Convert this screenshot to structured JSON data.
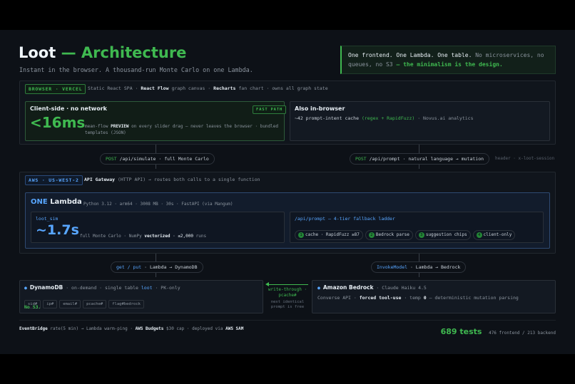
{
  "header": {
    "title_main": "Loot",
    "title_rest": "— Architecture",
    "subtitle": "Instant in the browser. A thousand-run Monte Carlo on one Lambda.",
    "callout_a": "One frontend. One Lambda. One table.",
    "callout_b": "No microservices, no queues, no S3",
    "callout_c": "— the minimalism is the design."
  },
  "browser": {
    "tag": "BROWSER · VERCEL",
    "desc_a": "Static React SPA ·",
    "desc_b": "React Flow",
    "desc_c": "graph canvas ·",
    "desc_d": "Recharts",
    "desc_e": "fan chart · owns all graph state",
    "client": {
      "title": "Client-side · no network",
      "badge": "FAST PATH",
      "metric": "<16ms",
      "desc_a": "mean-flow",
      "desc_b": "PREVIEW",
      "desc_c": "on every slider drag — never leaves the browser ·",
      "desc_d": "bundled templates (JSON)"
    },
    "also": {
      "title": "Also in-browser",
      "desc_a": "~42 prompt-intent cache",
      "desc_b": "(regex + RapidFuzz)",
      "desc_c": "· Novus.ai analytics"
    }
  },
  "connectors": {
    "simulate_method": "POST",
    "simulate_text": "/api/simulate · full Monte Carlo",
    "prompt_method": "POST",
    "prompt_text": "/api/prompt · natural language → mutation",
    "header_note": "header · x-loot-session",
    "dynamo_method": "get / put",
    "dynamo_text": "· Lambda → DynamoDB",
    "bedrock_method": "InvokeModel",
    "bedrock_text": "· Lambda → Bedrock"
  },
  "aws": {
    "tag": "AWS · US-WEST-2",
    "desc_a": "API Gateway",
    "desc_b": "(HTTP API) → routes both calls to a single function",
    "lambda": {
      "title_a": "ONE",
      "title_b": "Lambda",
      "specs": "Python 3.12 · arm64 · 3008 MB · 30s · FastAPI (via Mangum)",
      "sim": {
        "label": "loot_sim",
        "metric": "~1.7s",
        "desc_a": "full Monte Carlo · NumPy",
        "desc_b": "vectorized",
        "desc_c": "· ≤2,000",
        "desc_d": "runs"
      },
      "prompt": {
        "label": "/api/prompt — 4-tier fallback ladder",
        "steps": [
          {
            "n": "1",
            "text": "cache · RapidFuzz ≥87"
          },
          {
            "n": "2",
            "text": "Bedrock parse"
          },
          {
            "n": "3",
            "text": "suggestion chips"
          },
          {
            "n": "4",
            "text": "client-only"
          }
        ]
      }
    }
  },
  "dynamo": {
    "title": "DynamoDB",
    "desc_a": "· on-demand · single table",
    "desc_b": "loot",
    "desc_c": "· PK-only",
    "keys": [
      "sid#",
      "ip#",
      "email#",
      "pcache#",
      "flag#bedrock"
    ],
    "note": "No S3."
  },
  "write_through": {
    "label_a": "write-through ·",
    "label_b": "pcache#",
    "note_a": "next identical",
    "note_b": "prompt is free"
  },
  "bedrock": {
    "title": "Amazon Bedrock",
    "model": "· Claude Haiku 4.5",
    "desc_a": "Converse API ·",
    "desc_b": "forced tool-use",
    "desc_c": "· temp",
    "desc_d": "0",
    "desc_e": "— deterministic mutation parsing"
  },
  "footer": {
    "a": "EventBridge",
    "b": "rate(5 min) → Lambda warm-ping ·",
    "c": "AWS Budgets",
    "d": "$30 cap ·",
    "e": "deployed via",
    "f": "AWS SAM",
    "tests_count": "689 tests",
    "tests_detail": "476 frontend / 213 backend"
  },
  "colors": {
    "background": "#0d1117",
    "green_accent": "#3fb950",
    "blue_accent": "#58a6ff"
  }
}
